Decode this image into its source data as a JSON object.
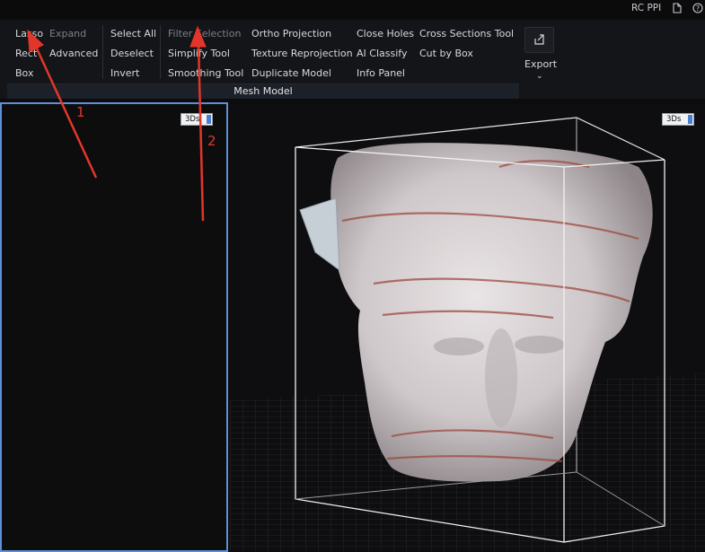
{
  "titlebar": {
    "app_name": "RC PPI"
  },
  "ribbon": {
    "selection": {
      "lasso": "Lasso",
      "rect": "Rect",
      "box": "Box",
      "expand": "Expand",
      "advanced": "Advanced",
      "select_all": "Select All",
      "deselect": "Deselect",
      "invert": "Invert"
    },
    "tools": {
      "filter_selection": "Filter Selection",
      "simplify_tool": "Simplify Tool",
      "smoothing_tool": "Smoothing Tool",
      "ortho_projection": "Ortho Projection",
      "texture_reprojection": "Texture Reprojection",
      "duplicate_model": "Duplicate Model",
      "close_holes": "Close Holes",
      "ai_classify": "AI Classify",
      "info_panel": "Info Panel",
      "cross_sections_tool": "Cross Sections Tool",
      "cut_by_box": "Cut by Box"
    },
    "group_label": "Mesh Model",
    "export_label": "Export"
  },
  "viewports": {
    "left_badge": "3Ds",
    "right_badge": "3Ds"
  },
  "annotations": {
    "arrow1_label": "1",
    "arrow2_label": "2"
  },
  "colors": {
    "accent_blue": "#5d90d6",
    "annotation_red": "#e3362a"
  }
}
